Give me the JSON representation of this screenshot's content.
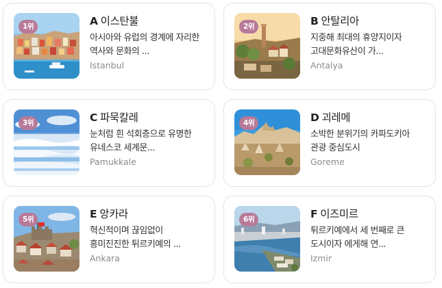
{
  "cards": [
    {
      "rank": "1위",
      "letter": "A",
      "name": "이스탄불",
      "desc": "아시아와 유럽의 경계에 자리한 역사와 문화의 ...",
      "sub": "Istanbul"
    },
    {
      "rank": "2위",
      "letter": "B",
      "name": "안탈리아",
      "desc": "지중해 최대의 휴양지이자 고대문화유산이 가...",
      "sub": "Antalya"
    },
    {
      "rank": "3위",
      "letter": "C",
      "name": "파묵칼레",
      "desc": "눈처럼 흰 석회층으로 유명한 유네스코 세계문...",
      "sub": "Pamukkale"
    },
    {
      "rank": "4위",
      "letter": "D",
      "name": "괴레메",
      "desc": "소박한 분위기의 카파도키아 관광 중심도시",
      "sub": "Goreme"
    },
    {
      "rank": "5위",
      "letter": "E",
      "name": "앙카라",
      "desc": "혁신적이며 끊임없이 흥미진진한 튀르키예의 ...",
      "sub": "Ankara"
    },
    {
      "rank": "6위",
      "letter": "F",
      "name": "이즈미르",
      "desc": "튀르키예에서 세 번째로 큰 도시이자 에게해 연...",
      "sub": "Izmir"
    }
  ]
}
